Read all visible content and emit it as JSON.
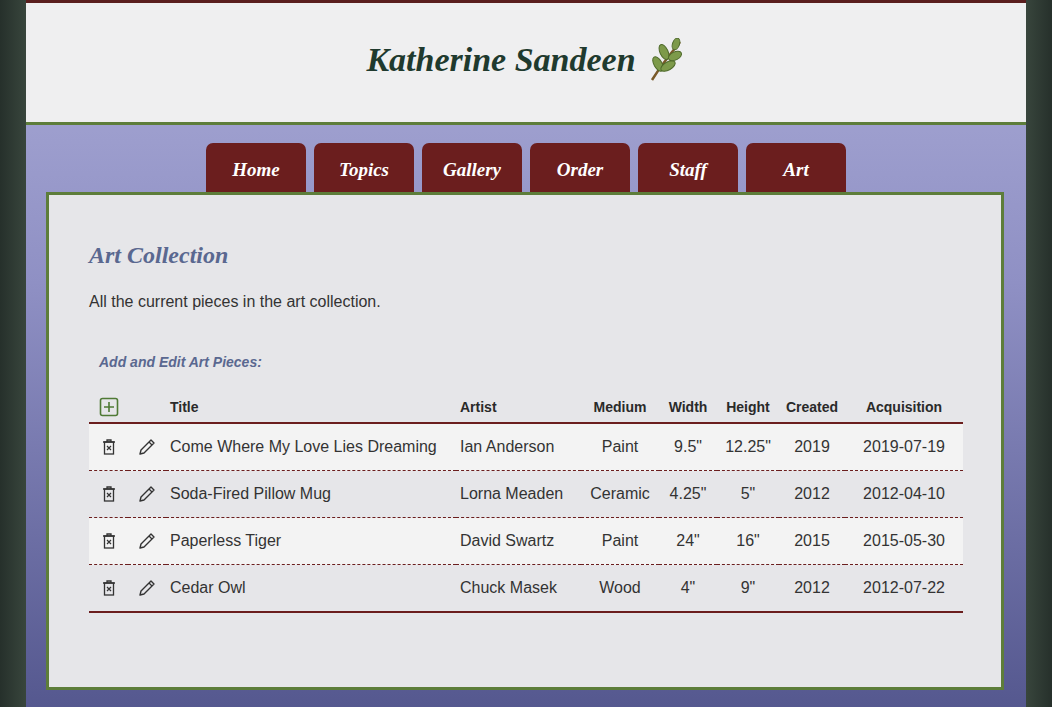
{
  "site": {
    "title": "Katherine Sandeen"
  },
  "nav": [
    {
      "label": "Home"
    },
    {
      "label": "Topics"
    },
    {
      "label": "Gallery"
    },
    {
      "label": "Order"
    },
    {
      "label": "Staff"
    },
    {
      "label": "Art"
    }
  ],
  "page": {
    "heading": "Art Collection",
    "intro": "All the current pieces in the art collection.",
    "section_label": "Add and Edit Art Pieces:"
  },
  "table": {
    "columns": [
      "Title",
      "Artist",
      "Medium",
      "Width",
      "Height",
      "Created",
      "Acquisition"
    ],
    "rows": [
      {
        "title": "Come Where My Love Lies Dreaming",
        "artist": "Ian Anderson",
        "medium": "Paint",
        "width": "9.5\"",
        "height": "12.25\"",
        "created": "2019",
        "acquisition": "2019-07-19"
      },
      {
        "title": "Soda-Fired Pillow Mug",
        "artist": "Lorna Meaden",
        "medium": "Ceramic",
        "width": "4.25\"",
        "height": "5\"",
        "created": "2012",
        "acquisition": "2012-04-10"
      },
      {
        "title": "Paperless Tiger",
        "artist": "David Swartz",
        "medium": "Paint",
        "width": "24\"",
        "height": "16\"",
        "created": "2015",
        "acquisition": "2015-05-30"
      },
      {
        "title": "Cedar Owl",
        "artist": "Chuck Masek",
        "medium": "Wood",
        "width": "4\"",
        "height": "9\"",
        "created": "2012",
        "acquisition": "2012-07-22"
      }
    ]
  }
}
